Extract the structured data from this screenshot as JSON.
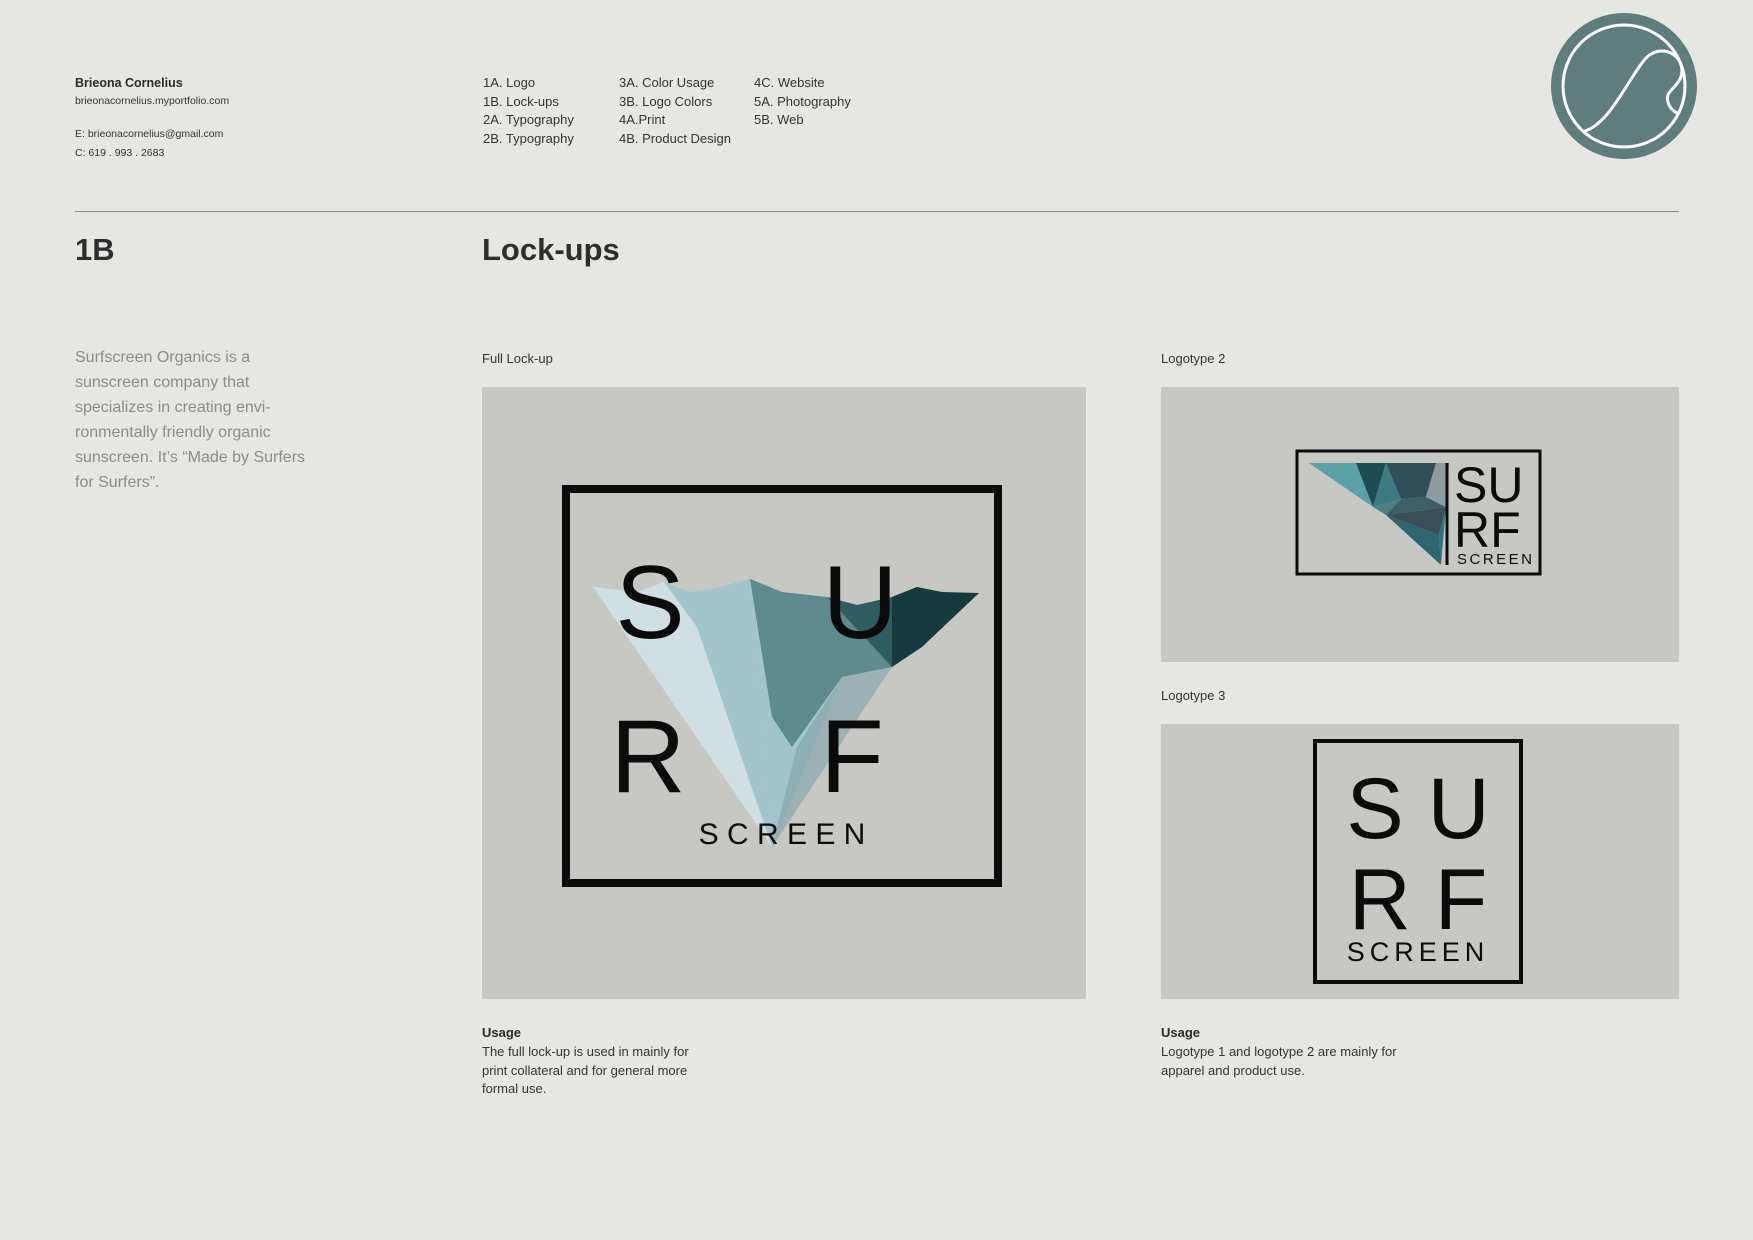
{
  "contact": {
    "name": "Brieona Cornelius",
    "website": "brieonacornelius.myportfolio.com",
    "email": "E: brieonacornelius@gmail.com",
    "phone": "C: 619 . 993 . 2683"
  },
  "nav": {
    "col1": [
      "1A. Logo",
      "1B. Lock-ups",
      "2A. Typography",
      "2B. Typography"
    ],
    "col2": [
      "3A. Color Usage",
      "3B. Logo Colors",
      "4A.Print",
      "4B. Product Design"
    ],
    "col3": [
      "4C. Website",
      "5A. Photography",
      "5B. Web"
    ]
  },
  "badge": {
    "icon": "wave-icon",
    "color": "#5e7d7c"
  },
  "section": {
    "number": "1B",
    "title": "Lock-ups",
    "description": "Surfscreen Organics is a sunscreen company that specializes in creating envi-ronmentally friendly organic sunscreen. It’s “Made by Surfers for Surfers”."
  },
  "panels": {
    "full": {
      "label": "Full Lock-up",
      "logo": {
        "top_left": "S",
        "top_right": "U",
        "bottom_left": "R",
        "bottom_right": "F",
        "sub": "S C R E E N"
      }
    },
    "logotype2": {
      "label": "Logotype 2",
      "logo": {
        "line1": "SU",
        "line2": "RF",
        "sub": "SCREEN"
      }
    },
    "logotype3": {
      "label": "Logotype 3",
      "logo": {
        "line1": "S U",
        "line2": "R F",
        "sub": "SCREEN"
      }
    }
  },
  "usage": {
    "full": {
      "heading": "Usage",
      "text": "The full lock-up is used in mainly for print collateral and for general more formal use."
    },
    "logotypes": {
      "heading": "Usage",
      "text": "Logotype 1 and logotype 2 are mainly for apparel and product use."
    }
  },
  "colors": {
    "background": "#e6e6e2",
    "panel": "#c7c7c3",
    "teal_dark": "#173a3f",
    "teal_mid": "#5f8a8e",
    "teal_light": "#a2c4cb",
    "teal_pale": "#cfdfe2"
  }
}
